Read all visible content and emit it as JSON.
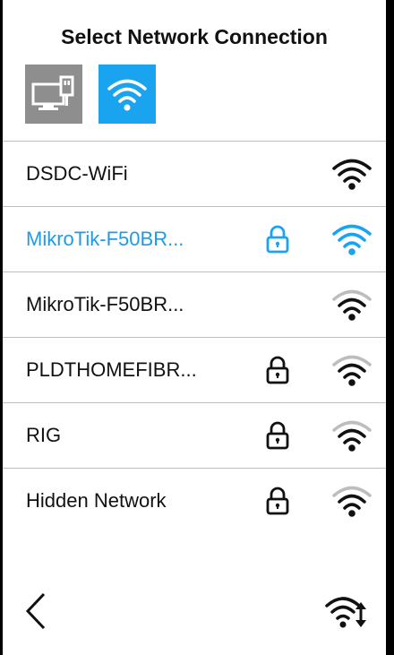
{
  "header": {
    "title": "Select Network Connection"
  },
  "connection_types": [
    {
      "id": "wired",
      "icon": "ethernet-monitor-icon",
      "selected": false
    },
    {
      "id": "wifi",
      "icon": "wifi-icon",
      "selected": true
    }
  ],
  "networks": [
    {
      "name": "DSDC-WiFi",
      "locked": false,
      "selected": false,
      "signal": "strong"
    },
    {
      "name": "MikroTik-F50BR...",
      "locked": true,
      "selected": true,
      "signal": "strong"
    },
    {
      "name": "MikroTik-F50BR...",
      "locked": false,
      "selected": false,
      "signal": "medium"
    },
    {
      "name": "PLDTHOMEFIBR...",
      "locked": true,
      "selected": false,
      "signal": "medium"
    },
    {
      "name": "RIG",
      "locked": true,
      "selected": false,
      "signal": "medium"
    },
    {
      "name": "Hidden Network",
      "locked": true,
      "selected": false,
      "signal": "medium"
    }
  ],
  "footer": {
    "back_icon": "chevron-left-icon",
    "settings_icon": "wifi-settings-icon"
  },
  "colors": {
    "accent": "#1aa3ef",
    "selected_text": "#1f9be6",
    "wired_button": "#8e8e8e",
    "divider": "#bdbdbd",
    "frame": "#000000"
  }
}
